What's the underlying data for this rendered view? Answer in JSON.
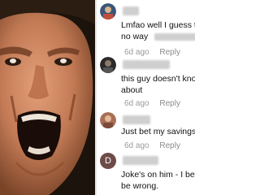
{
  "comments": [
    {
      "avatar_letter": "",
      "text_line1": "Lmfao well I guess th",
      "text_line2": "no way",
      "age": "6d ago",
      "reply_label": "Reply"
    },
    {
      "avatar_letter": "",
      "text_line1": "this guy doesn't kno",
      "text_line2": "about",
      "age": "6d ago",
      "reply_label": "Reply"
    },
    {
      "avatar_letter": "",
      "text_line1": "Just bet my savings",
      "text_line2": "",
      "age": "6d ago",
      "reply_label": "Reply"
    },
    {
      "avatar_letter": "D",
      "text_line1": "Joke's on him - I bet",
      "text_line2": "be wrong.",
      "age": "",
      "reply_label": ""
    }
  ],
  "colors": {
    "meta_text": "#9a9a9a",
    "letter_avatar_bg": "#6d4b47"
  }
}
